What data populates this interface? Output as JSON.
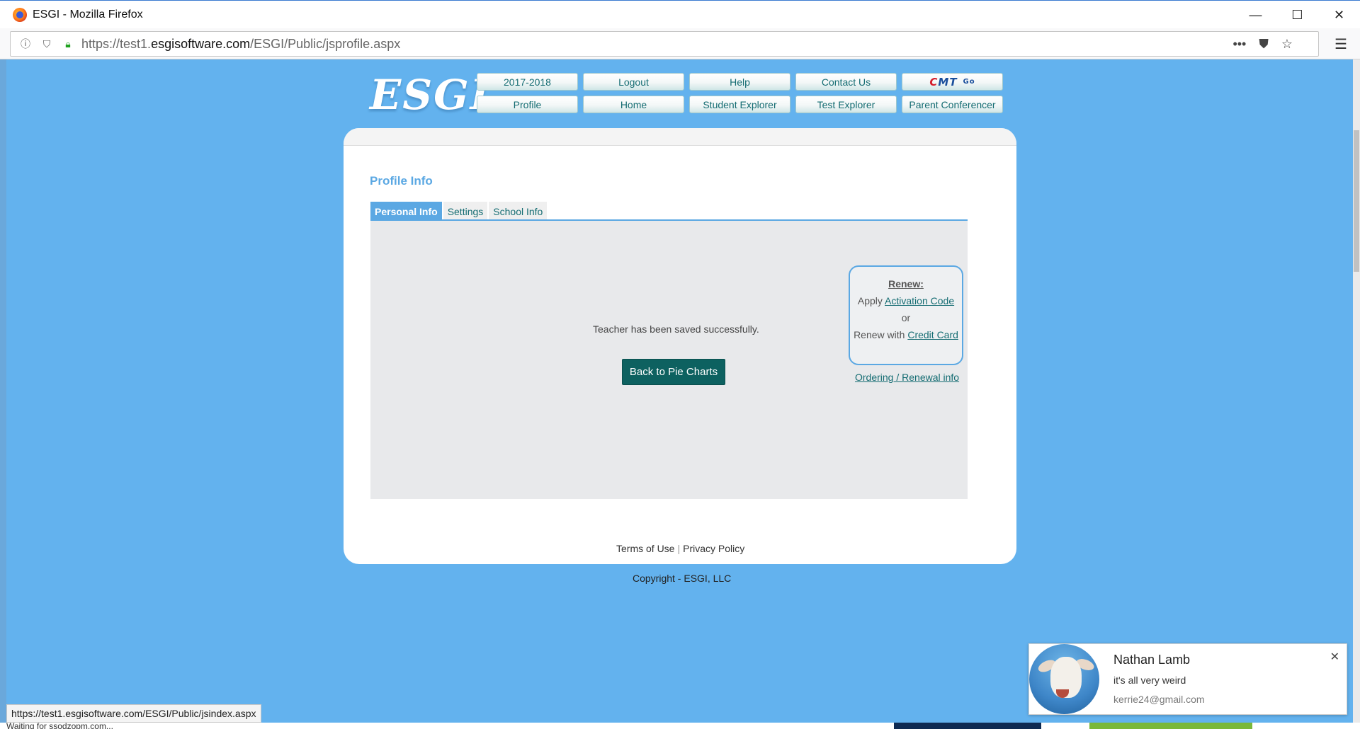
{
  "window": {
    "title": "ESGI - Mozilla Firefox",
    "controls": {
      "minimize": "—",
      "maximize": "☐",
      "close": "✕"
    }
  },
  "browser": {
    "url_prefix": "https://test1.",
    "url_domain": "esgisoftware.com",
    "url_path": "/ESGI/Public/jsprofile.aspx",
    "status_url": "https://test1.esgisoftware.com/ESGI/Public/jsindex.aspx",
    "status_under": "Waiting for ssodzopm.com..."
  },
  "site": {
    "logo": "ESGI",
    "nav_row1": [
      "2017-2018",
      "Logout",
      "Help",
      "Contact Us"
    ],
    "cmt": {
      "c": "C",
      "m": "M",
      "t": "T",
      "go": "Go"
    },
    "nav_row2": [
      "Profile",
      "Home",
      "Student Explorer",
      "Test Explorer",
      "Parent Conferencer"
    ]
  },
  "profile": {
    "title": "Profile Info",
    "tabs": [
      "Personal Info",
      "Settings",
      "School Info"
    ],
    "message": "Teacher has been saved successfully.",
    "back_button": "Back to Pie Charts"
  },
  "renew": {
    "title": "Renew:",
    "apply_prefix": "Apply",
    "activation_link": "Activation Code",
    "or": "or",
    "renew_prefix": "Renew with",
    "credit_link": "Credit Card",
    "ordering_link": "Ordering / Renewal info"
  },
  "footer": {
    "terms": "Terms of Use",
    "separator": "|",
    "privacy": "Privacy Policy",
    "copyright": "Copyright - ESGI, LLC"
  },
  "notification": {
    "name": "Nathan Lamb",
    "message": "it's all very weird",
    "email": "kerrie24@gmail.com",
    "close": "✕"
  }
}
